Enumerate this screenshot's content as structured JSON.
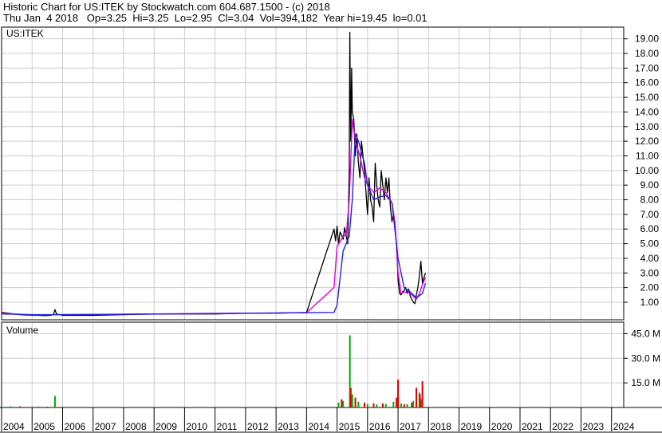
{
  "header": {
    "line1": "Historic Chart for US:ITEK by Stockwatch.com 604.687.1500 - (c) 2018",
    "line2": "Thu Jan  4 2018   Op=3.25  Hi=3.25  Lo=2.95  Cl=3.04  Vol=394,182  Year hi=19.45  lo=0.01"
  },
  "chart_data": [
    {
      "type": "line",
      "title": "US:ITEK",
      "y_ticks": [
        "1.00",
        "2.00",
        "3.00",
        "4.00",
        "5.00",
        "6.00",
        "7.00",
        "8.00",
        "9.00",
        "10.00",
        "11.00",
        "12.00",
        "13.00",
        "14.00",
        "15.00",
        "16.00",
        "17.00",
        "18.00",
        "19.00"
      ],
      "ylim": [
        -0.2,
        19.8
      ],
      "xlim": [
        2004,
        2024.4
      ],
      "grid": true,
      "colors": {
        "price": "#000000",
        "ma_short": "#dd00dd",
        "ma_long": "#2222dd",
        "candle_down": "#dd0000"
      },
      "series": [
        {
          "key": "price",
          "x": [
            2004.0,
            2004.2,
            2004.4,
            2004.6,
            2004.8,
            2005.0,
            2005.2,
            2005.4,
            2005.6,
            2005.7,
            2005.75,
            2005.8,
            2006.0,
            2007.0,
            2008.0,
            2009.0,
            2010.0,
            2011.0,
            2012.0,
            2013.0,
            2014.0,
            2014.9,
            2014.95,
            2015.0,
            2015.05,
            2015.1,
            2015.15,
            2015.2,
            2015.25,
            2015.3,
            2015.35,
            2015.4,
            2015.42,
            2015.45,
            2015.48,
            2015.5,
            2015.55,
            2015.6,
            2015.65,
            2015.7,
            2015.75,
            2015.8,
            2015.85,
            2015.9,
            2015.95,
            2016.0,
            2016.05,
            2016.1,
            2016.15,
            2016.2,
            2016.25,
            2016.3,
            2016.35,
            2016.4,
            2016.45,
            2016.5,
            2016.55,
            2016.6,
            2016.65,
            2016.7,
            2016.75,
            2016.8,
            2016.85,
            2016.9,
            2016.95,
            2017.0,
            2017.05,
            2017.1,
            2017.15,
            2017.2,
            2017.25,
            2017.3,
            2017.35,
            2017.4,
            2017.45,
            2017.5,
            2017.55,
            2017.6,
            2017.65,
            2017.7,
            2017.75,
            2017.8,
            2017.85,
            2017.9
          ],
          "y": [
            0.3,
            0.25,
            0.2,
            0.15,
            0.12,
            0.1,
            0.1,
            0.08,
            0.1,
            0.15,
            0.5,
            0.2,
            0.1,
            0.1,
            0.15,
            0.2,
            0.2,
            0.2,
            0.25,
            0.25,
            0.3,
            6.0,
            5.2,
            6.2,
            5.0,
            5.8,
            5.6,
            5.3,
            6.1,
            5.5,
            5.0,
            10.0,
            19.45,
            12.0,
            17.0,
            14.0,
            13.5,
            11.0,
            12.5,
            10.5,
            9.5,
            12.0,
            11.0,
            10.0,
            8.5,
            7.0,
            9.5,
            8.0,
            7.5,
            6.5,
            10.5,
            9.0,
            8.0,
            7.5,
            10.0,
            9.0,
            8.0,
            9.5,
            8.5,
            9.5,
            7.5,
            6.5,
            7.0,
            6.0,
            5.0,
            2.5,
            1.6,
            1.5,
            1.7,
            1.8,
            2.0,
            1.6,
            1.9,
            1.4,
            1.2,
            1.0,
            0.9,
            1.5,
            2.0,
            2.8,
            3.8,
            2.3,
            2.7,
            3.0
          ]
        },
        {
          "key": "ma_short",
          "x": [
            2004.0,
            2005.0,
            2006.0,
            2010.0,
            2014.0,
            2014.9,
            2015.0,
            2015.2,
            2015.3,
            2015.4,
            2015.5,
            2015.6,
            2015.75,
            2015.9,
            2016.0,
            2016.2,
            2016.4,
            2016.6,
            2016.8,
            2016.9,
            2017.0,
            2017.1,
            2017.2,
            2017.4,
            2017.6,
            2017.7,
            2017.8,
            2017.9
          ],
          "y": [
            0.25,
            0.12,
            0.15,
            0.22,
            0.28,
            2.0,
            4.8,
            5.5,
            5.6,
            8.0,
            13.5,
            12.0,
            11.0,
            9.5,
            9.0,
            8.5,
            8.8,
            8.5,
            7.8,
            6.5,
            3.0,
            1.6,
            1.7,
            1.6,
            1.2,
            1.6,
            2.2,
            2.7
          ]
        },
        {
          "key": "ma_long",
          "x": [
            2004.0,
            2005.0,
            2006.0,
            2010.0,
            2014.9,
            2015.0,
            2015.2,
            2015.4,
            2015.5,
            2015.6,
            2015.7,
            2015.9,
            2016.0,
            2016.2,
            2016.4,
            2016.6,
            2016.8,
            2017.0,
            2017.2,
            2017.4,
            2017.6,
            2017.8,
            2017.9
          ],
          "y": [
            0.2,
            0.15,
            0.15,
            0.2,
            0.3,
            0.8,
            4.5,
            5.5,
            8.0,
            12.5,
            12.0,
            10.5,
            9.0,
            8.0,
            8.2,
            8.3,
            7.8,
            4.0,
            2.0,
            1.7,
            1.3,
            1.6,
            2.3
          ]
        }
      ]
    },
    {
      "type": "bar",
      "title": "Volume",
      "y_ticks": [
        "15.0 M",
        "30.0 M",
        "45.0 M"
      ],
      "ylim": [
        0,
        52
      ],
      "x_ticks": [
        "2004",
        "2005",
        "2006",
        "2007",
        "2008",
        "2009",
        "2010",
        "2011",
        "2012",
        "2013",
        "2014",
        "2015",
        "2016",
        "2017",
        "2018",
        "2019",
        "2020",
        "2021",
        "2022",
        "2023",
        "2024"
      ],
      "colors": {
        "up": "#00aa00",
        "down": "#dd0000",
        "grid": "#cccccc"
      },
      "series": [
        {
          "name": "up",
          "x": [
            2004.3,
            2005.2,
            2005.75,
            2015.05,
            2015.2,
            2015.42,
            2015.5,
            2015.7,
            2016.0,
            2016.3,
            2016.6,
            2016.85,
            2017.1,
            2017.3,
            2017.5,
            2017.7,
            2017.75
          ],
          "y": [
            0.8,
            0.6,
            7.0,
            3.0,
            4.0,
            44.0,
            8.0,
            3.5,
            2.0,
            1.8,
            2.2,
            3.5,
            2.5,
            2.0,
            4.0,
            9.0,
            5.0
          ]
        },
        {
          "name": "down",
          "x": [
            2004.6,
            2005.5,
            2015.15,
            2015.45,
            2015.6,
            2015.9,
            2016.2,
            2016.5,
            2016.95,
            2017.0,
            2017.2,
            2017.45,
            2017.6,
            2017.72,
            2017.8
          ],
          "y": [
            0.7,
            0.5,
            5.0,
            12.0,
            6.0,
            3.0,
            2.5,
            2.5,
            6.0,
            17.0,
            2.0,
            3.0,
            12.0,
            8.0,
            16.0
          ]
        }
      ]
    }
  ]
}
